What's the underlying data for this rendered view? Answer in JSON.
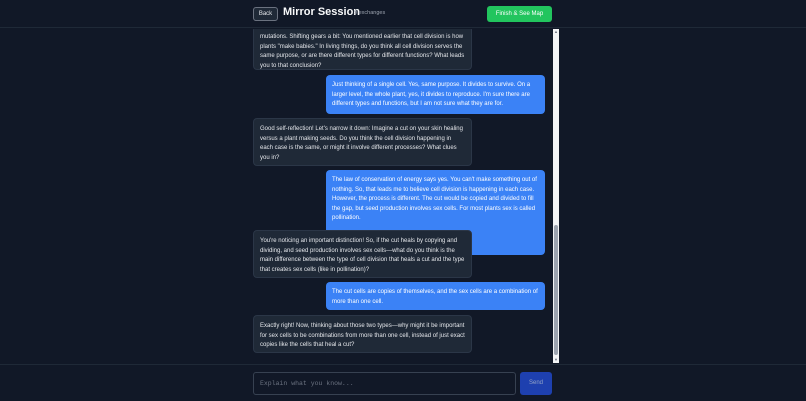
{
  "header": {
    "back_label": "Back",
    "title": "Mirror Session",
    "exchanges": "9 exchanges",
    "finish_label": "Finish & See Map"
  },
  "messages": [
    {
      "role": "ai",
      "text": "mutations. Shifting gears a bit: You mentioned earlier that cell division is how plants \"make babies.\" In living things, do you think all cell division serves the same purpose, or are there different types for different functions? What leads you to that conclusion?"
    },
    {
      "role": "user",
      "text": "Just thinking of a single cell. Yes, same purpose. It divides to survive. On a larger level, the whole plant, yes, it divides to reproduce. I'm sure there are different types and functions, but I am not sure what they are for."
    },
    {
      "role": "ai",
      "text": "Good self-reflection! Let's narrow it down: Imagine a cut on your skin healing versus a plant making seeds. Do you think the cell division happening in each case is the same, or might it involve different processes? What clues you in?"
    },
    {
      "role": "user",
      "text": "The law of conservation of energy says yes. You can't make something out of nothing. So, that leads me to believe cell division is happening in each case. However, the process is different. The cut would be copied and divided to fill the gap, but seed production involves sex cells. For most plants sex is called pollination."
    },
    {
      "role": "ai",
      "text": "You're noticing an important distinction! So, if the cut heals by copying and dividing, and seed production involves sex cells—what do you think is the main difference between the type of cell division that heals a cut and the type that creates sex cells (like in pollination)?"
    },
    {
      "role": "user",
      "text": "The cut cells are copies of themselves, and the sex cells are a combination of more than one cell."
    },
    {
      "role": "ai",
      "text": "Exactly right! Now, thinking about those two types—why might it be important for sex cells to be combinations from more than one cell, instead of just exact copies like the cells that heal a cut?"
    }
  ],
  "composer": {
    "placeholder": "Explain what you know...",
    "send_label": "Send"
  },
  "colors": {
    "background": "#111827",
    "ai_bubble": "#1f2937",
    "user_bubble": "#3b82f6",
    "finish_button": "#22c55e",
    "send_button": "#1e40af"
  }
}
